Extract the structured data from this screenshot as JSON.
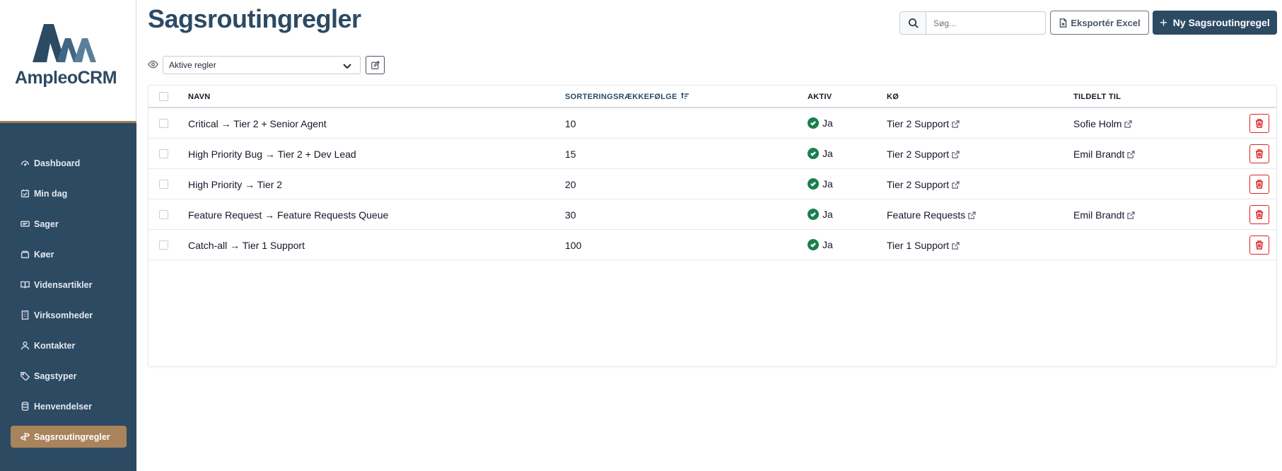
{
  "app": {
    "name": "AmpleoCRM",
    "brand_color": "#2d4a63",
    "accent_color": "#a9845b"
  },
  "sidebar": {
    "items": [
      {
        "label": "Dashboard",
        "icon": "dashboard-gauge-icon",
        "active": false
      },
      {
        "label": "Min dag",
        "icon": "calendar-check-icon",
        "active": false
      },
      {
        "label": "Sager",
        "icon": "ticket-icon",
        "active": false
      },
      {
        "label": "Køer",
        "icon": "inbox-stack-icon",
        "active": false
      },
      {
        "label": "Vidensartikler",
        "icon": "book-open-icon",
        "active": false
      },
      {
        "label": "Virksomheder",
        "icon": "building-icon",
        "active": false
      },
      {
        "label": "Kontakter",
        "icon": "person-icon",
        "active": false
      },
      {
        "label": "Sagstyper",
        "icon": "tag-icon",
        "active": false
      },
      {
        "label": "Henvendelser",
        "icon": "database-icon",
        "active": false
      },
      {
        "label": "Sagsroutingregler",
        "icon": "signpost-icon",
        "active": true
      }
    ]
  },
  "header": {
    "title": "Sagsroutingregler",
    "search_placeholder": "Søg...",
    "export_label": "Eksportér Excel",
    "new_label": "Ny Sagsroutingregel"
  },
  "view": {
    "selected": "Aktive regler"
  },
  "table": {
    "columns": [
      "NAVN",
      "SORTERINGSRÆKKEFØLGE",
      "AKTIV",
      "KØ",
      "TILDELT TIL"
    ],
    "sorted_column": "SORTERINGSRÆKKEFØLGE",
    "rows": [
      {
        "navn": "Critical → Tier 2 + Senior Agent",
        "order": "10",
        "aktiv": "Ja",
        "koe": "Tier 2 Support",
        "tildelt": "Sofie Holm"
      },
      {
        "navn": "High Priority Bug → Tier 2 + Dev Lead",
        "order": "15",
        "aktiv": "Ja",
        "koe": "Tier 2 Support",
        "tildelt": "Emil Brandt"
      },
      {
        "navn": "High Priority → Tier 2",
        "order": "20",
        "aktiv": "Ja",
        "koe": "Tier 2 Support",
        "tildelt": ""
      },
      {
        "navn": "Feature Request → Feature Requests Queue",
        "order": "30",
        "aktiv": "Ja",
        "koe": "Feature Requests",
        "tildelt": "Emil Brandt"
      },
      {
        "navn": "Catch-all → Tier 1 Support",
        "order": "100",
        "aktiv": "Ja",
        "koe": "Tier 1 Support",
        "tildelt": ""
      }
    ]
  }
}
